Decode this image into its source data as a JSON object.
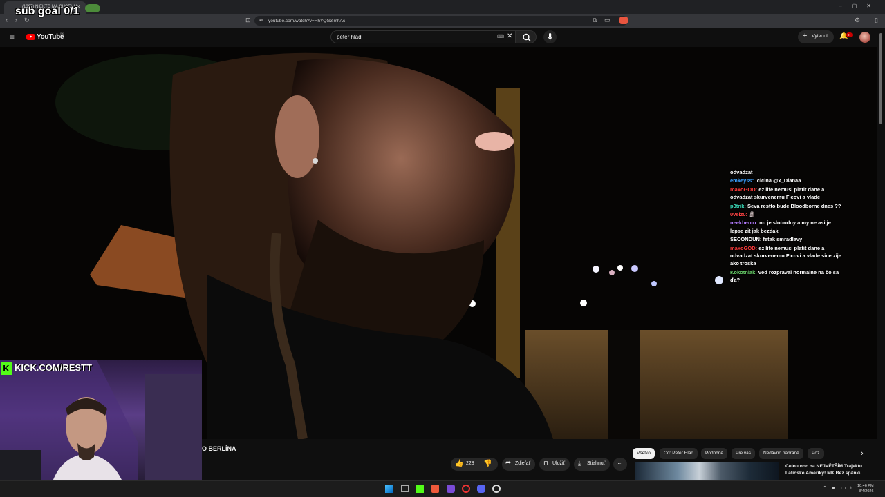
{
  "browser": {
    "tab_title": "(1397) NIEKTO MA CHCEL V...",
    "url": "youtube.com/watch?v=HhYQG3lmhAc"
  },
  "overlay": {
    "sub_goal": "sub goal 0/1",
    "kick_label": "KICK.COM/RESTT",
    "kick_letter": "K"
  },
  "youtube": {
    "logo_text": "YouTube",
    "region": "SK",
    "search_value": "peter hlad",
    "create_label": "Vytvoriť",
    "notifications_badge": "9+"
  },
  "chat": [
    {
      "user": "",
      "text": "odvadzat",
      "color": "#ffffff"
    },
    {
      "user": "emkeyss:",
      "text": "!cicina @x_Dianaa",
      "color": "#3aa0ff"
    },
    {
      "user": "maxoGOD:",
      "text": "ez life nemusi platit dane a odvadzat skurvenemu Ficovi a vlade",
      "color": "#ff3b3b"
    },
    {
      "user": "p3trik:",
      "text": "Seva restto bude Bloodborne dnes ??",
      "color": "#3bd9b8"
    },
    {
      "user": "0velz0:",
      "text": "🗿",
      "color": "#ff4444"
    },
    {
      "user": "neekherco:",
      "text": "no je slobodny a my ne asi je lepse zit jak bezdak",
      "color": "#b47cff"
    },
    {
      "user": "SECONDUN:",
      "text": "fetak smradlavy",
      "color": "#ffffff"
    },
    {
      "user": "maxoGOD:",
      "text": "ez life nemusi platit dane a odvadzat skurvenemu Ficovi a vlade sice zije ako troska",
      "color": "#ff3b3b"
    },
    {
      "user": "Kokotniak:",
      "text": "ved rozpraval normalne na čo sa ďa?",
      "color": "#6bd46b"
    }
  ],
  "video": {
    "title": "O BERLÍNA",
    "likes": "228",
    "share_label": "Zdieľať",
    "save_label": "Uložiť",
    "download_label": "Stiahnuť"
  },
  "chips": [
    "Všetko",
    "Od: Peter Hlad",
    "Podobné",
    "Pre vás",
    "Nedávno nahrané",
    "Poz"
  ],
  "related": {
    "title": "Celou noc na NEJVĚTŠÍM Trajektu Latinské Ameriky! MK Bez spánku.."
  },
  "taskbar": {
    "time": "10:46 PM",
    "date": "8/4/2026"
  },
  "colors": {
    "youtube_red": "#ff0000",
    "kick_green": "#53fc18"
  }
}
